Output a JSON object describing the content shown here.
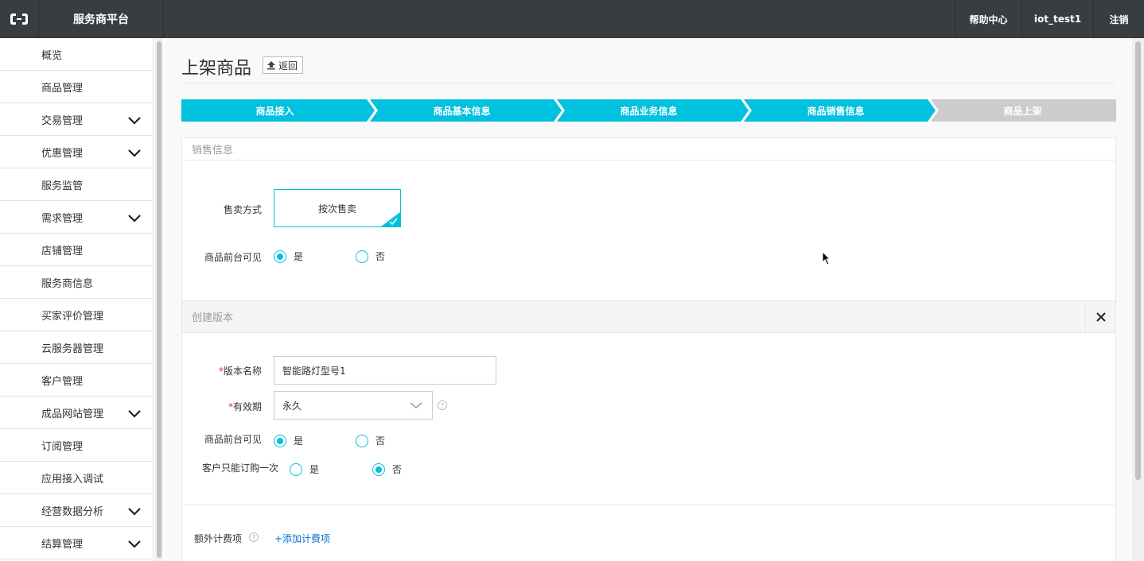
{
  "topbar": {
    "logo_icon": "aliyun-logo-icon",
    "brand": "服务商平台",
    "help": "帮助中心",
    "user": "iot_test1",
    "logout": "注销"
  },
  "sidebar": {
    "items": [
      {
        "label": "概览",
        "expandable": false
      },
      {
        "label": "商品管理",
        "expandable": false
      },
      {
        "label": "交易管理",
        "expandable": true
      },
      {
        "label": "优惠管理",
        "expandable": true
      },
      {
        "label": "服务监管",
        "expandable": false
      },
      {
        "label": "需求管理",
        "expandable": true
      },
      {
        "label": "店铺管理",
        "expandable": false
      },
      {
        "label": "服务商信息",
        "expandable": false
      },
      {
        "label": "买家评价管理",
        "expandable": false
      },
      {
        "label": "云服务器管理",
        "expandable": false
      },
      {
        "label": "客户管理",
        "expandable": false
      },
      {
        "label": "成品网站管理",
        "expandable": true
      },
      {
        "label": "订阅管理",
        "expandable": false
      },
      {
        "label": "应用接入调试",
        "expandable": false
      },
      {
        "label": "经营数据分析",
        "expandable": true
      },
      {
        "label": "结算管理",
        "expandable": true
      }
    ]
  },
  "page": {
    "title": "上架商品",
    "back": "返回"
  },
  "steps": [
    {
      "label": "商品接入",
      "done": true
    },
    {
      "label": "商品基本信息",
      "done": true
    },
    {
      "label": "商品业务信息",
      "done": true
    },
    {
      "label": "商品销售信息",
      "done": true
    },
    {
      "label": "商品上架",
      "done": false
    }
  ],
  "sales": {
    "header": "销售信息",
    "sale_mode_label": "售卖方式",
    "sale_mode_value": "按次售卖",
    "visible_label": "商品前台可见",
    "yes": "是",
    "no": "否",
    "visible_selected": "yes"
  },
  "version": {
    "header": "创建版本",
    "required_mark": "*",
    "name_label": "版本名称",
    "name_value": "智能路灯型号1",
    "validity_label": "有效期",
    "validity_value": "永久",
    "visible_label": "商品前台可见",
    "visible_selected": "yes",
    "once_label": "客户只能订购一次",
    "once_selected": "no",
    "yes": "是",
    "no": "否",
    "extra_fee_label": "额外计费项",
    "add_fee": "+添加计费项",
    "help_glyph": "?"
  },
  "colors": {
    "accent": "#00c1de",
    "topbar": "#373d41",
    "step_inactive": "#cccccc",
    "link": "#0070cc",
    "required": "#e0331c"
  }
}
